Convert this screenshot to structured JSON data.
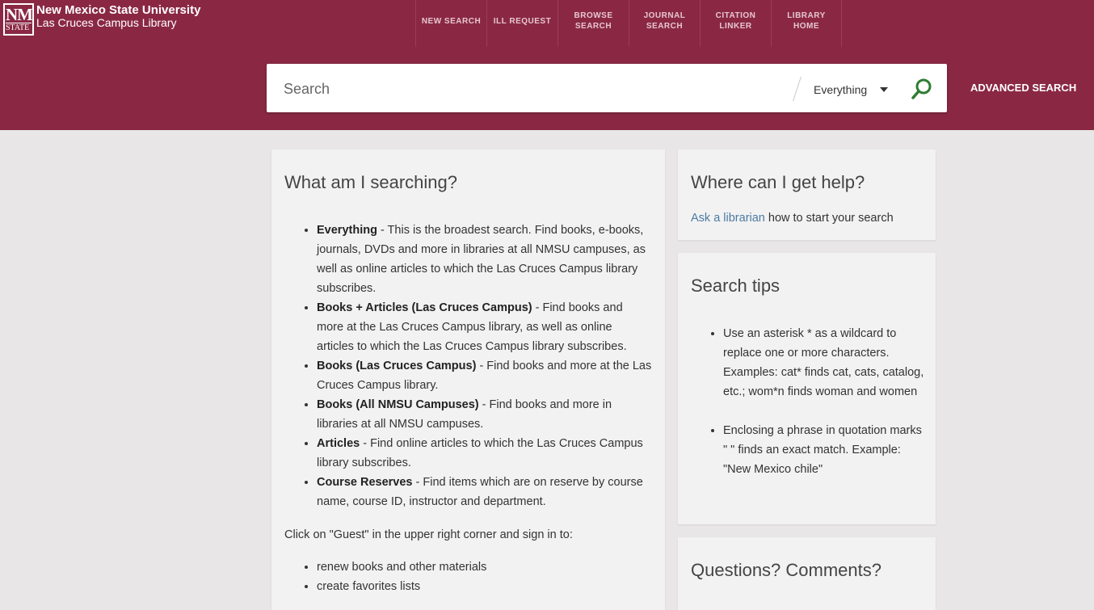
{
  "header": {
    "university": "New Mexico State University",
    "campus": "Las Cruces Campus Library",
    "logo_nm": "NM",
    "logo_state": "STATE",
    "nav": [
      {
        "line1": "NEW SEARCH",
        "line2": ""
      },
      {
        "line1": "ILL REQUEST",
        "line2": ""
      },
      {
        "line1": "BROWSE",
        "line2": "SEARCH"
      },
      {
        "line1": "JOURNAL",
        "line2": "SEARCH"
      },
      {
        "line1": "CITATION",
        "line2": "LINKER"
      },
      {
        "line1": "LIBRARY",
        "line2": "HOME"
      }
    ]
  },
  "search": {
    "placeholder": "Search",
    "value": "",
    "scope": "Everything",
    "advanced": "ADVANCED SEARCH"
  },
  "main": {
    "title": "What am I searching?",
    "items": [
      {
        "term": "Everything",
        "desc": " - This is the broadest search. Find books, e-books, journals, DVDs and more in libraries at all NMSU campuses, as well as online articles to which the Las Cruces Campus library subscribes."
      },
      {
        "term": "Books + Articles (Las Cruces Campus)",
        "desc": " - Find books and more at the Las Cruces Campus library, as well as online articles to which the Las Cruces Campus library subscribes."
      },
      {
        "term": "Books (Las Cruces Campus)",
        "desc": " - Find books and more at the Las Cruces Campus library."
      },
      {
        "term": "Books (All NMSU Campuses)",
        "desc": " - Find books and more in libraries at all NMSU campuses."
      },
      {
        "term": "Articles",
        "desc": " - Find online articles to which the Las Cruces Campus library subscribes."
      },
      {
        "term": "Course Reserves",
        "desc": " - Find items which are on reserve by course name, course ID, instructor and department."
      }
    ],
    "guest_text": "Click on \"Guest\" in the upper right corner and sign in to:",
    "guest_items": [
      "renew books and other materials",
      "create favorites lists"
    ]
  },
  "help": {
    "title": "Where can I get help?",
    "link": "Ask a librarian",
    "text": " how to start your search"
  },
  "tips": {
    "title": "Search tips",
    "items": [
      "Use an asterisk * as a wildcard to replace one or more characters. Examples: cat* finds cat, cats, catalog, etc.; wom*n finds woman and women",
      "Enclosing a phrase in quotation marks \" \" finds an exact match. Example: \"New Mexico chile\""
    ]
  },
  "questions": {
    "title": "Questions? Comments?"
  },
  "colors": {
    "brand": "#8a2844",
    "search_icon": "#2e7d32",
    "link": "#4b7aa3"
  },
  "icons": {
    "search": "search-icon",
    "dropdown": "chevron-down-icon"
  }
}
